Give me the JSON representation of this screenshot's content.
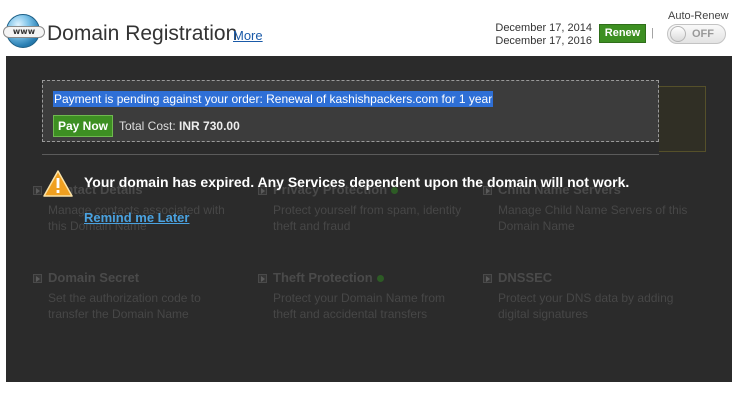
{
  "header": {
    "logo_text": "www",
    "title": "Domain Registration",
    "more_link": "More",
    "date_registered": "December 17, 2014",
    "date_expires": "December 17, 2016",
    "renew_label": "Renew",
    "separator": "|",
    "auto_renew_label": "Auto-Renew",
    "auto_renew_state": "OFF"
  },
  "payment": {
    "message": "Payment is pending against your order: Renewal of kashishpackers.com for 1 year",
    "pay_now_label": "Pay Now",
    "total_cost_label": "Total Cost:",
    "total_cost_value": "INR 730.00"
  },
  "services": [
    {
      "title": "Contact Details",
      "desc": "Manage contacts associated with this Domain Name"
    },
    {
      "title": "Privacy Protection",
      "desc": "Protect yourself from spam, identity theft and fraud"
    },
    {
      "title": "Child Name Servers",
      "desc": "Manage Child Name Servers of this Domain Name"
    },
    {
      "title": "Domain Secret",
      "desc": "Set the authorization code to transfer the Domain Name"
    },
    {
      "title": "Theft Protection",
      "desc": "Protect your Domain Name from theft and accidental transfers"
    },
    {
      "title": "DNSSEC",
      "desc": "Protect your DNS data by adding digital signatures"
    }
  ],
  "alert": {
    "message": "Your domain has expired. Any Services dependent upon the domain will not work.",
    "remind_link": "Remind me Later",
    "icon": "warning-icon",
    "icon_color": "#f0a020"
  },
  "colors": {
    "accent_green": "#3d8f22",
    "link_blue": "#1a5aa8",
    "overlay": "#2b2b2b",
    "selection": "#2e6fd6"
  }
}
